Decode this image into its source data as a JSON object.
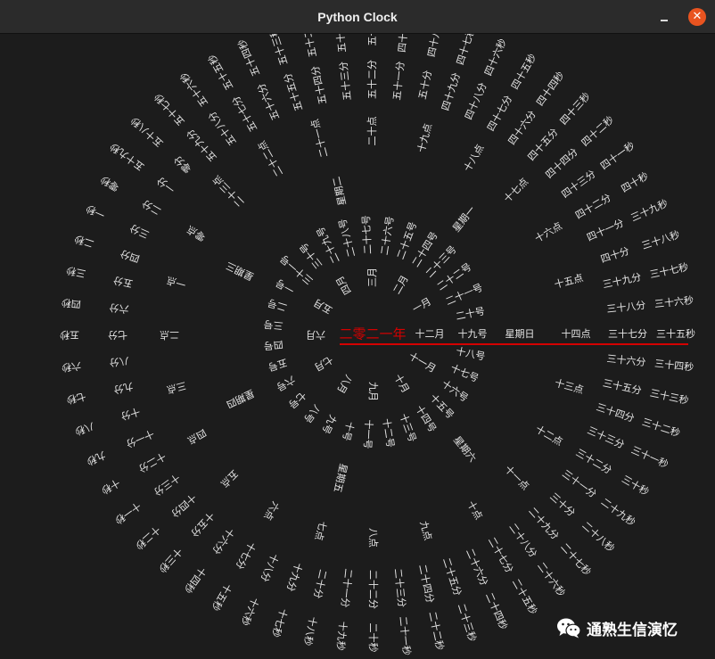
{
  "window": {
    "title": "Python Clock",
    "close_glyph": "✕"
  },
  "colors": {
    "background": "#1c1c1c",
    "text": "#e6e6e6",
    "highlight": "#d40000",
    "close": "#e95420"
  },
  "clock": {
    "year": "二零二一年",
    "month_ring": [
      "一月",
      "二月",
      "三月",
      "四月",
      "五月",
      "六月",
      "七月",
      "八月",
      "九月",
      "十月",
      "十一月",
      "十二月"
    ],
    "day_ring": [
      "一号",
      "二号",
      "三号",
      "四号",
      "五号",
      "六号",
      "七号",
      "八号",
      "九号",
      "十号",
      "十一号",
      "十二号",
      "十三号",
      "十四号",
      "十五号",
      "十六号",
      "十七号",
      "十八号",
      "十九号",
      "二十号",
      "二十一号",
      "二十二号",
      "二十三号",
      "二十四号",
      "二十五号",
      "二十六号",
      "二十七号",
      "二十八号",
      "二十九号",
      "三十号",
      "三十一号"
    ],
    "weekday_ring": [
      "星期一",
      "星期二",
      "星期三",
      "星期四",
      "星期五",
      "星期六",
      "星期日"
    ],
    "hour_ring": [
      "零点",
      "一点",
      "二点",
      "三点",
      "四点",
      "五点",
      "六点",
      "七点",
      "八点",
      "九点",
      "十点",
      "十一点",
      "十二点",
      "十三点",
      "十四点",
      "十五点",
      "十六点",
      "十七点",
      "十八点",
      "十九点",
      "二十点",
      "二十一点",
      "二十二点",
      "二十三点"
    ],
    "minute_ring": [
      "零分",
      "一分",
      "二分",
      "三分",
      "四分",
      "五分",
      "六分",
      "七分",
      "八分",
      "九分",
      "十分",
      "十一分",
      "十二分",
      "十三分",
      "十四分",
      "十五分",
      "十六分",
      "十七分",
      "十八分",
      "十九分",
      "二十分",
      "二十一分",
      "二十二分",
      "二十三分",
      "二十四分",
      "二十五分",
      "二十六分",
      "二十七分",
      "二十八分",
      "二十九分",
      "三十分",
      "三十一分",
      "三十二分",
      "三十三分",
      "三十四分",
      "三十五分",
      "三十六分",
      "三十七分",
      "三十八分",
      "三十九分",
      "四十分",
      "四十一分",
      "四十二分",
      "四十三分",
      "四十四分",
      "四十五分",
      "四十六分",
      "四十七分",
      "四十八分",
      "四十九分",
      "五十分",
      "五十一分",
      "五十二分",
      "五十三分",
      "五十四分",
      "五十五分",
      "五十六分",
      "五十七分",
      "五十八分",
      "五十九分"
    ],
    "second_ring": [
      "零秒",
      "一秒",
      "二秒",
      "三秒",
      "四秒",
      "五秒",
      "六秒",
      "七秒",
      "八秒",
      "九秒",
      "十秒",
      "十一秒",
      "十二秒",
      "十三秒",
      "十四秒",
      "十五秒",
      "十六秒",
      "十七秒",
      "十八秒",
      "十九秒",
      "二十秒",
      "二十一秒",
      "二十二秒",
      "二十三秒",
      "二十四秒",
      "二十五秒",
      "二十六秒",
      "二十七秒",
      "二十八秒",
      "二十九秒",
      "三十秒",
      "三十一秒",
      "三十二秒",
      "三十三秒",
      "三十四秒",
      "三十五秒",
      "三十六秒",
      "三十七秒",
      "三十八秒",
      "三十九秒",
      "四十秒",
      "四十一秒",
      "四十二秒",
      "四十三秒",
      "四十四秒",
      "四十五秒",
      "四十六秒",
      "四十七秒",
      "四十八秒",
      "四十九秒",
      "五十秒",
      "五十一秒",
      "五十二秒",
      "五十三秒",
      "五十四秒",
      "五十五秒",
      "五十六秒",
      "五十七秒",
      "五十八秒",
      "五十九秒"
    ],
    "current": {
      "month": "十二月",
      "day": "十九号",
      "weekday": "星期日",
      "hour": "十四点",
      "minute": "三十七分",
      "second": "三十五秒"
    }
  },
  "watermark": {
    "icon": "wechat-icon",
    "text": "通熟生信演忆"
  }
}
